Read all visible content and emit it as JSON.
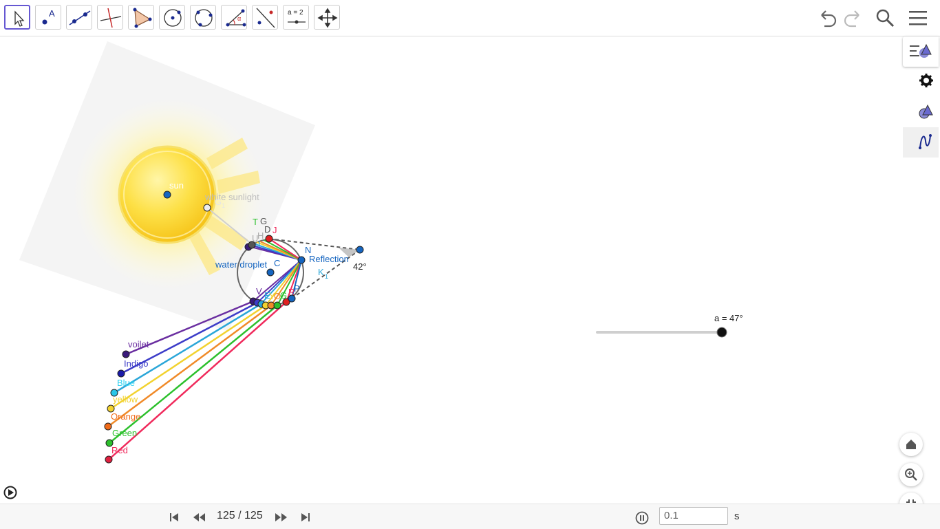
{
  "toolbar": {
    "tools": [
      {
        "name": "move-tool",
        "label": ""
      },
      {
        "name": "point-tool",
        "label": "A"
      },
      {
        "name": "line-tool",
        "label": ""
      },
      {
        "name": "perpendicular-tool",
        "label": ""
      },
      {
        "name": "polygon-tool",
        "label": ""
      },
      {
        "name": "circle-tool",
        "label": ""
      },
      {
        "name": "circle-three-points-tool",
        "label": ""
      },
      {
        "name": "angle-tool",
        "label": "α"
      },
      {
        "name": "reflect-tool",
        "label": ""
      },
      {
        "name": "slider-tool",
        "label": "a = 2"
      },
      {
        "name": "move-view-tool",
        "label": ""
      }
    ]
  },
  "labels": {
    "sun": "sun",
    "white_sunlight": "white sunlight",
    "g1": "G",
    "g1_sub": "1",
    "water_droplet": "water droplet",
    "c": "C",
    "n": "N",
    "reflection": "Reflection",
    "k1": "K",
    "k1_sub": "1",
    "angle": "42°",
    "t": "T",
    "g": "G",
    "d": "D",
    "j": "J",
    "h": "H",
    "u": "U",
    "i": "I",
    "v": "V",
    "e": "E",
    "y": "Y",
    "o": "O",
    "gg": "G",
    "r": "R",
    "p": "P",
    "voilet": "voilet",
    "indigo": "Indigo",
    "blue": "Blue",
    "yellow": "yellow",
    "orange": "Orange",
    "green": "Green",
    "red": "Red"
  },
  "slider": {
    "label": "a = 47°",
    "value_deg": 47
  },
  "animation": {
    "frame": "125 / 125",
    "speed": "0.1",
    "unit": "s"
  },
  "colors": {
    "accent": "#6557d2",
    "voilet": "#6a2ea0",
    "indigo": "#3c3cc8",
    "blue": "#2aa6d8",
    "yellow": "#f2d22e",
    "orange": "#f08a28",
    "green": "#2cc02c",
    "red": "#f02a5c",
    "point_blue": "#1565c0"
  }
}
